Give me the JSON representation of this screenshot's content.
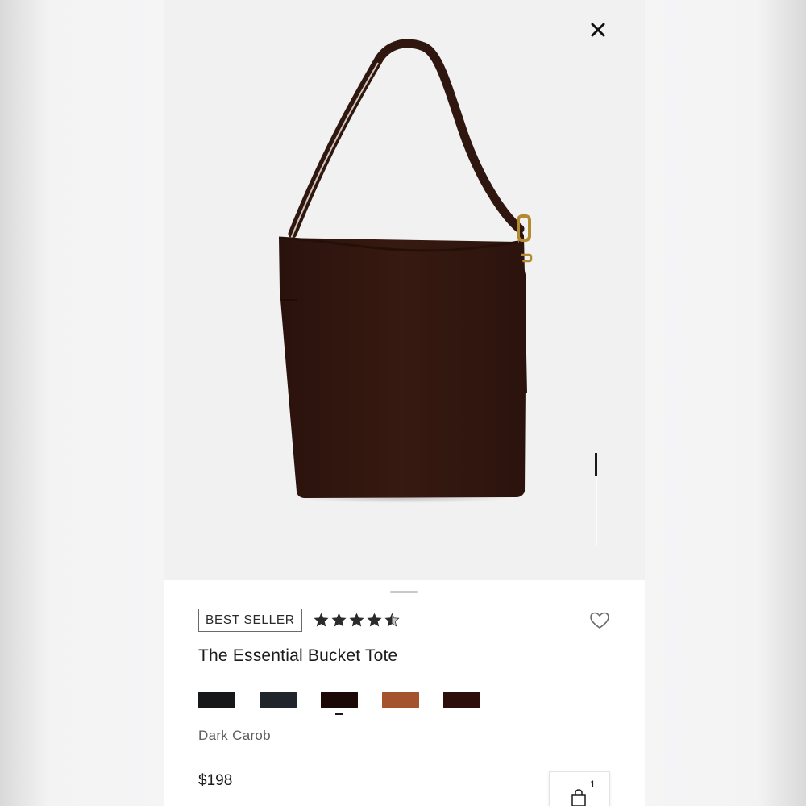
{
  "product": {
    "badge": "BEST SELLER",
    "rating": 4.5,
    "title": "The Essential Bucket Tote",
    "selected_color_name": "Dark Carob",
    "price": "$198"
  },
  "swatches": [
    {
      "color": "#17181a"
    },
    {
      "color": "#20242b"
    },
    {
      "color": "#1c0806",
      "selected": true
    },
    {
      "color": "#a4532e"
    },
    {
      "color": "#2e0e0a"
    }
  ],
  "cart": {
    "count": "1"
  },
  "icons": {
    "close": "close-icon",
    "heart": "heart-icon",
    "cart": "shopping-bag-icon",
    "star": "star-icon"
  },
  "gallery": {
    "image_index": 1,
    "image_count": 4
  }
}
